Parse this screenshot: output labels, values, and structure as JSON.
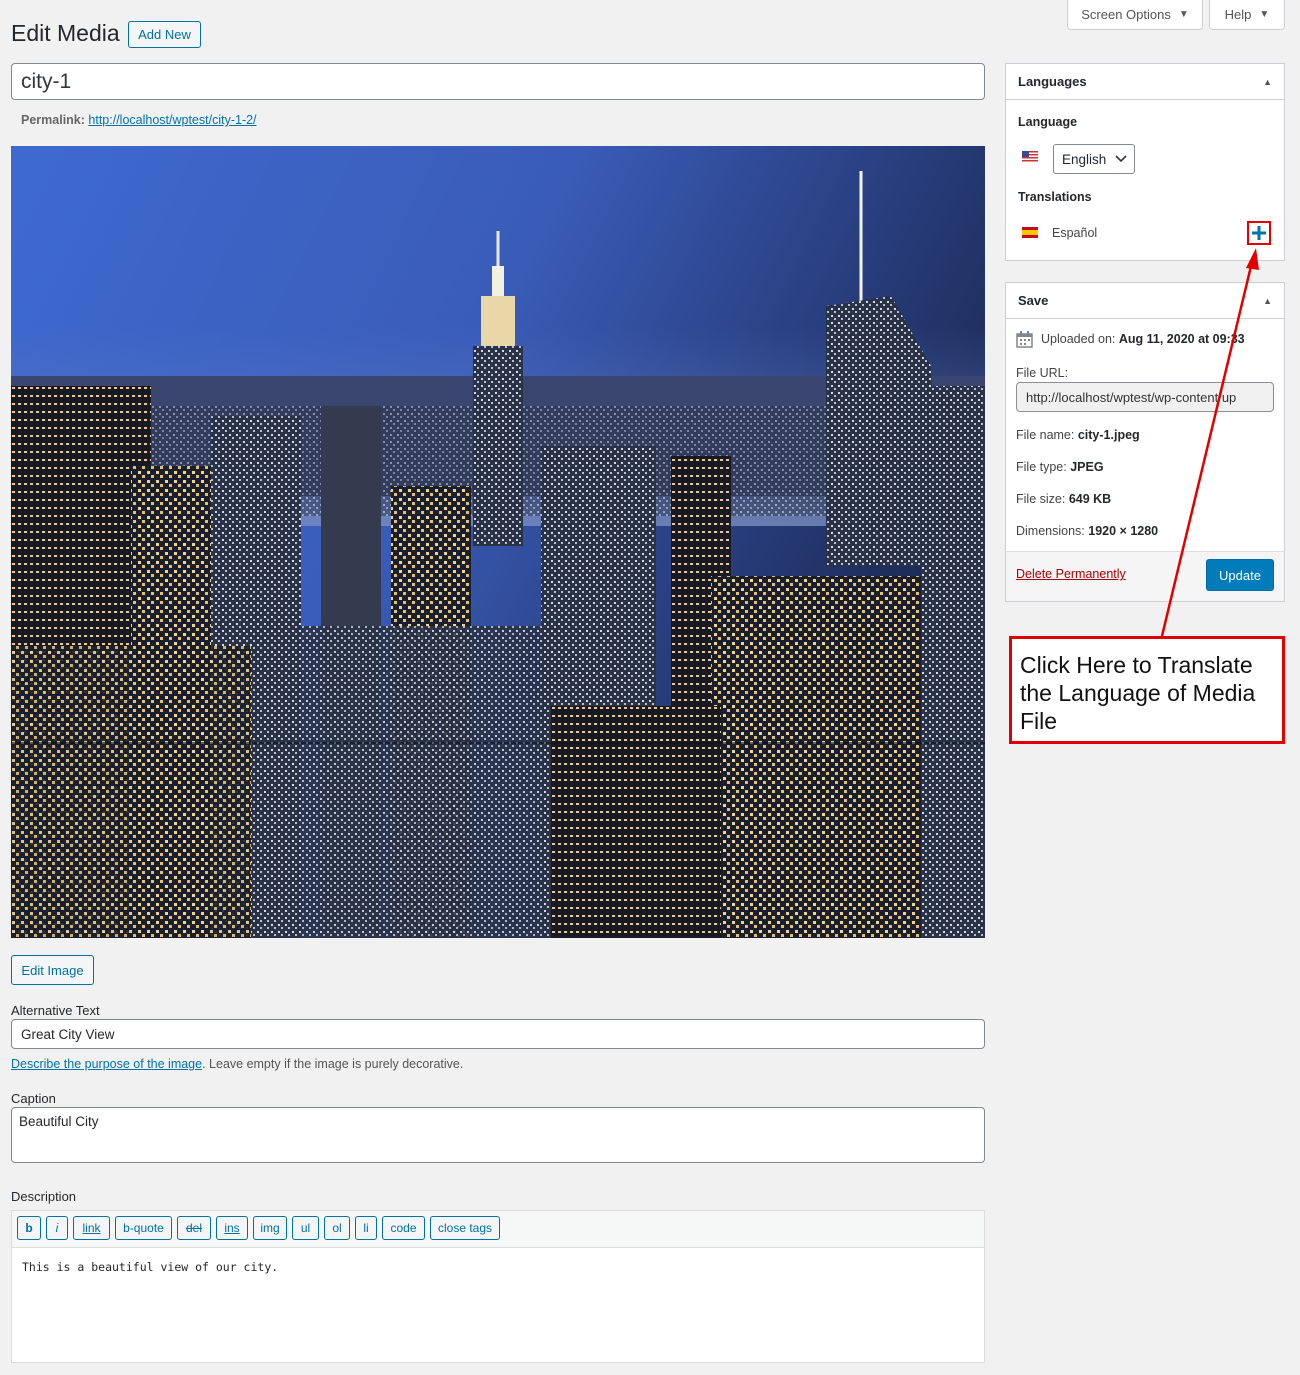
{
  "header": {
    "title": "Edit Media",
    "add_new": "Add New",
    "screen_options": "Screen Options",
    "help": "Help"
  },
  "post": {
    "title": "city-1",
    "permalink_label": "Permalink:",
    "permalink_url": "http://localhost/wptest/city-1-2/"
  },
  "image_actions": {
    "edit_image": "Edit Image"
  },
  "fields": {
    "alt_label": "Alternative Text",
    "alt_value": "Great City View",
    "alt_help_link": "Describe the purpose of the image",
    "alt_help_rest": ". Leave empty if the image is purely decorative.",
    "caption_label": "Caption",
    "caption_value": "Beautiful City",
    "description_label": "Description",
    "description_value": "This is a beautiful view of our city."
  },
  "quicktags": [
    "b",
    "i",
    "link",
    "b-quote",
    "del",
    "ins",
    "img",
    "ul",
    "ol",
    "li",
    "code",
    "close tags"
  ],
  "languages_box": {
    "title": "Languages",
    "language_label": "Language",
    "selected_language": "English",
    "translations_label": "Translations",
    "translation_name": "Español"
  },
  "save_box": {
    "title": "Save",
    "uploaded_label": "Uploaded on:",
    "uploaded_value": "Aug 11, 2020 at 09:33",
    "file_url_label": "File URL:",
    "file_url_value": "http://localhost/wptest/wp-content/up",
    "file_name_label": "File name:",
    "file_name_value": "city-1.jpeg",
    "file_type_label": "File type:",
    "file_type_value": "JPEG",
    "file_size_label": "File size:",
    "file_size_value": "649 KB",
    "dimensions_label": "Dimensions:",
    "dimensions_value": "1920 × 1280",
    "delete": "Delete Permanently",
    "update": "Update"
  },
  "annotation": {
    "text": "Click Here to Translate the Language of Media File",
    "color": "#e00000"
  },
  "icons": {
    "dropdown": "chevron-down-icon",
    "collapse": "triangle-up-icon",
    "calendar": "calendar-icon",
    "add_translation": "plus-icon"
  }
}
